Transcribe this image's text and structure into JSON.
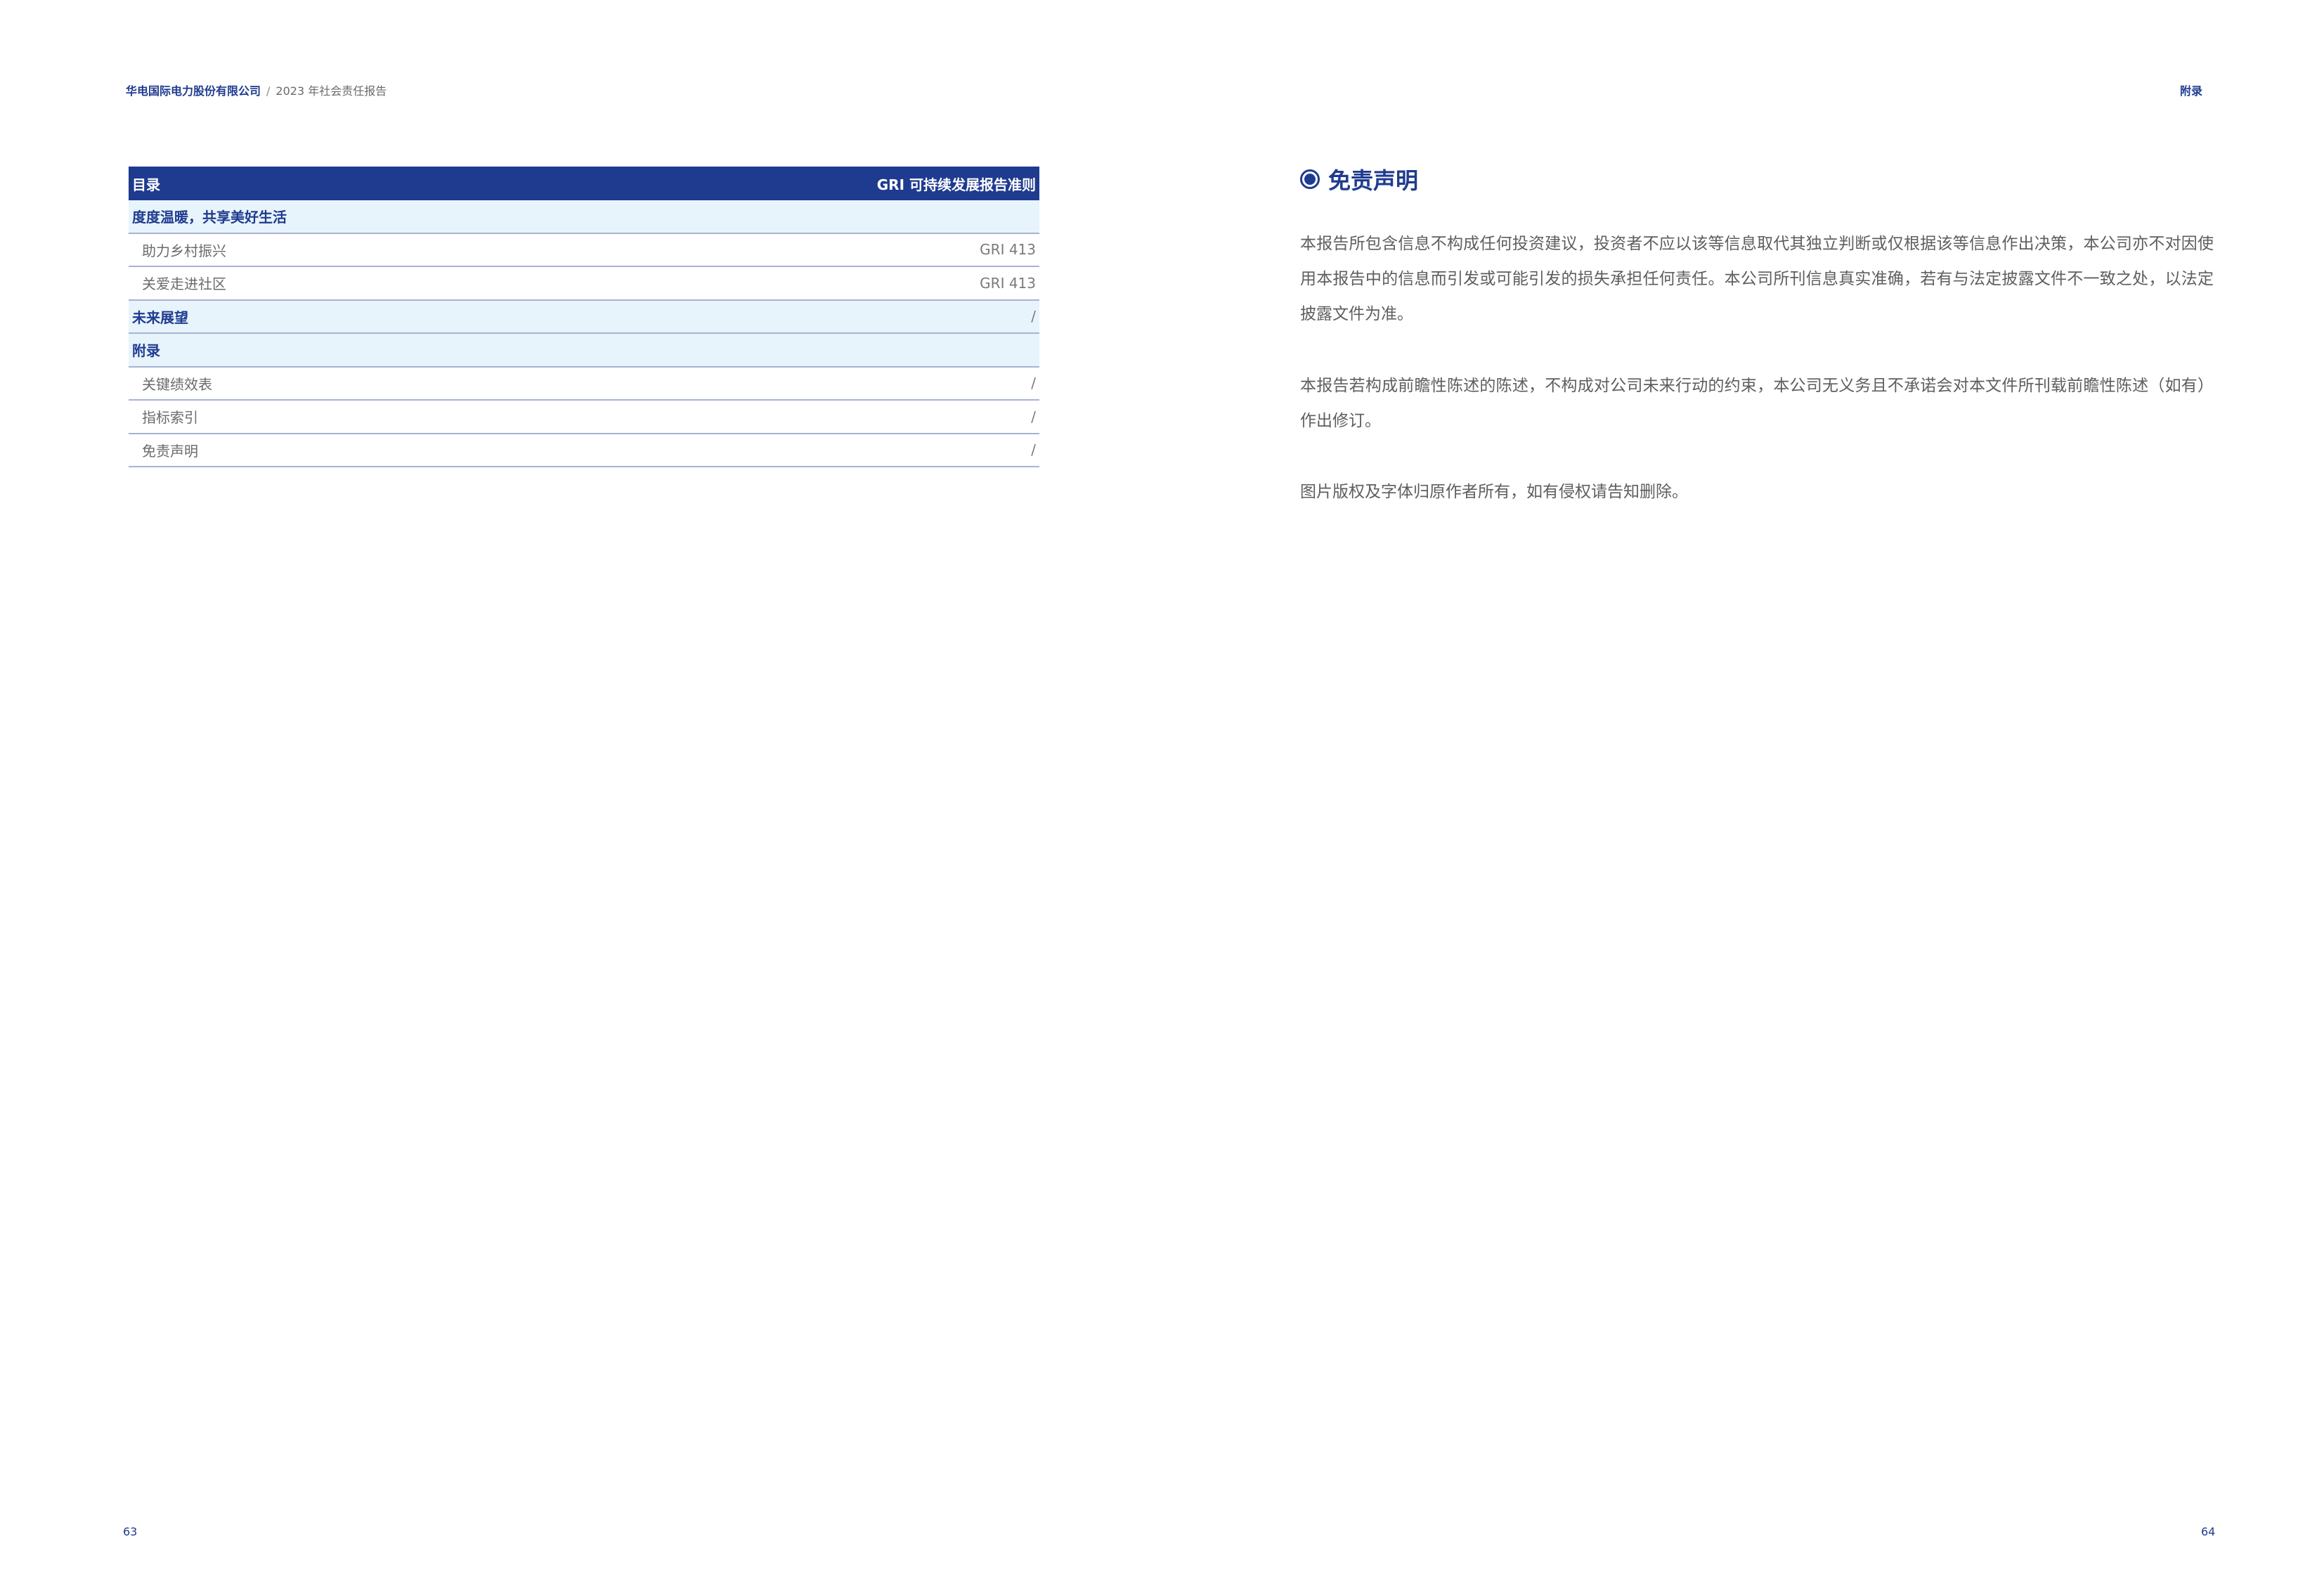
{
  "header": {
    "company": "华电国际电力股份有限公司",
    "separator": "/",
    "report": "2023 年社会责任报告",
    "section": "附录"
  },
  "table": {
    "header": {
      "left": "目录",
      "right": "GRI 可持续发展报告准则"
    },
    "rows": [
      {
        "type": "section",
        "label": "度度温暖，共享美好生活",
        "value": ""
      },
      {
        "type": "item",
        "label": "助力乡村振兴",
        "value": "GRI 413"
      },
      {
        "type": "item",
        "label": "关爱走进社区",
        "value": "GRI 413"
      },
      {
        "type": "section",
        "label": "未来展望",
        "value": "/"
      },
      {
        "type": "section",
        "label": "附录",
        "value": ""
      },
      {
        "type": "item",
        "label": "关键绩效表",
        "value": "/"
      },
      {
        "type": "item",
        "label": "指标索引",
        "value": "/"
      },
      {
        "type": "item",
        "label": "免责声明",
        "value": "/"
      }
    ]
  },
  "disclaimer": {
    "title": "免责声明",
    "paragraphs": [
      "本报告所包含信息不构成任何投资建议，投资者不应以该等信息取代其独立判断或仅根据该等信息作出决策，本公司亦不对因使用本报告中的信息而引发或可能引发的损失承担任何责任。本公司所刊信息真实准确，若有与法定披露文件不一致之处，以法定披露文件为准。",
      "本报告若构成前瞻性陈述的陈述，不构成对公司未来行动的约束，本公司无义务且不承诺会对本文件所刊载前瞻性陈述（如有）作出修订。",
      "图片版权及字体归原作者所有，如有侵权请告知删除。"
    ]
  },
  "page_numbers": {
    "left": "63",
    "right": "64"
  }
}
